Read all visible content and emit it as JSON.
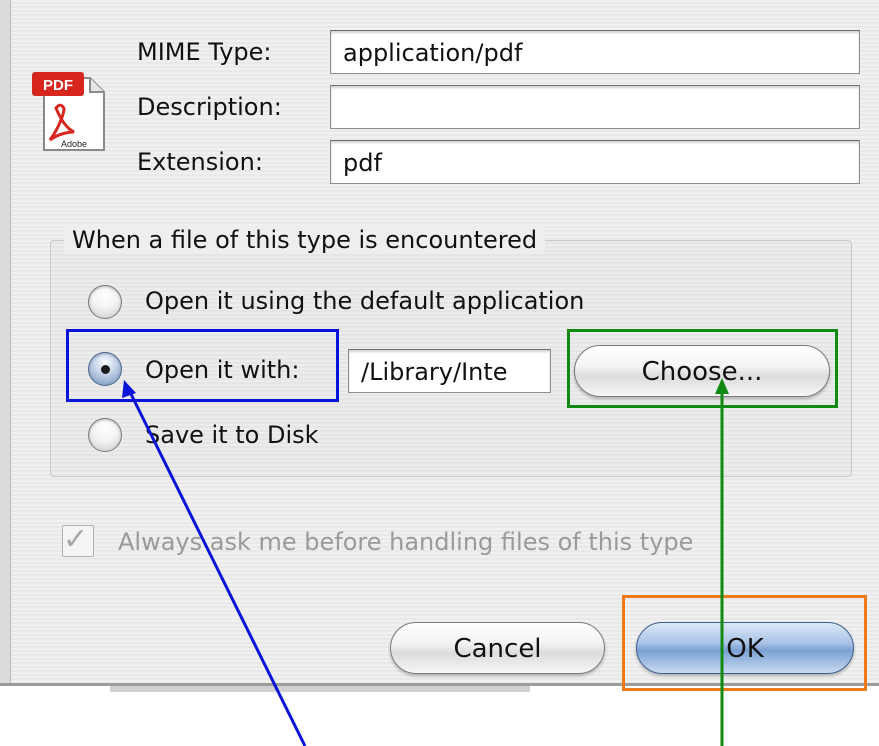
{
  "fields": {
    "mime_label": "MIME Type:",
    "mime_value": "application/pdf",
    "description_label": "Description:",
    "description_value": "",
    "extension_label": "Extension:",
    "extension_value": "pdf"
  },
  "icon": {
    "badge": "PDF",
    "caption": "Adobe",
    "name": "pdf-document-icon"
  },
  "handling": {
    "title": "When a file of this type is encountered",
    "option_default": "Open it using the default application",
    "option_open_with": "Open it with:",
    "open_with_path": "/Library/Inte",
    "option_save": "Save it to Disk",
    "selected": "open_with",
    "choose_button": "Choose..."
  },
  "always_ask": {
    "label": "Always ask me before handling files of this type",
    "checked": true,
    "enabled": false
  },
  "buttons": {
    "cancel": "Cancel",
    "ok": "OK"
  },
  "annotations": {
    "blue": "#0a14d8",
    "green": "#118a11",
    "orange": "#f07a1a"
  }
}
